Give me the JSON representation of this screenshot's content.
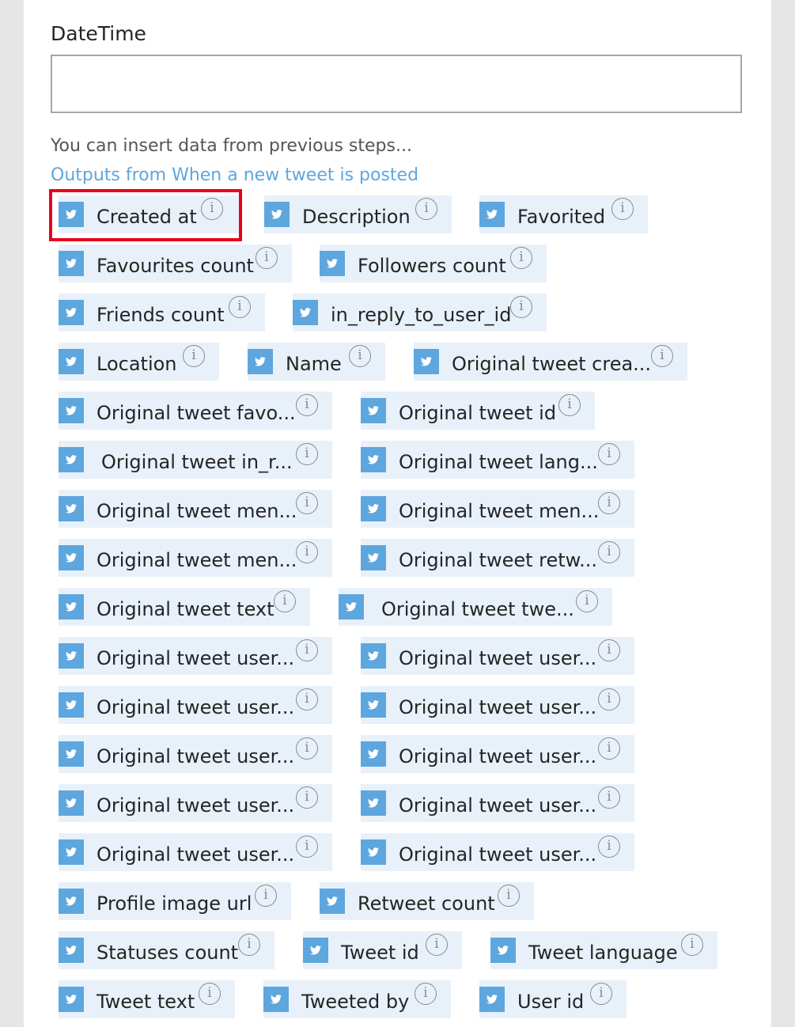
{
  "field": {
    "label": "DateTime",
    "value": ""
  },
  "hint": "You can insert data from previous steps...",
  "outputs_link": "Outputs from When a new tweet is posted",
  "tokens": [
    {
      "label": "Created at",
      "icon": "twitter-icon",
      "highlighted": true
    },
    {
      "label": "Description",
      "icon": "twitter-icon"
    },
    {
      "label": "Favorited",
      "icon": "twitter-icon"
    },
    {
      "label": "Favourites count",
      "icon": "twitter-icon"
    },
    {
      "label": "Followers count",
      "icon": "twitter-icon"
    },
    {
      "label": "Friends count",
      "icon": "twitter-icon"
    },
    {
      "label": "in_reply_to_user_id",
      "icon": "twitter-icon"
    },
    {
      "label": "Location",
      "icon": "twitter-icon"
    },
    {
      "label": "Name",
      "icon": "twitter-icon"
    },
    {
      "label": "Original tweet crea...",
      "icon": "twitter-icon"
    },
    {
      "label": "Original tweet favo...",
      "icon": "twitter-icon"
    },
    {
      "label": "Original tweet id",
      "icon": "twitter-icon"
    },
    {
      "label": "Original tweet in_r...",
      "icon": "twitter-icon"
    },
    {
      "label": "Original tweet lang...",
      "icon": "twitter-icon"
    },
    {
      "label": "Original tweet men...",
      "icon": "twitter-icon"
    },
    {
      "label": "Original tweet men...",
      "icon": "twitter-icon"
    },
    {
      "label": "Original tweet men...",
      "icon": "twitter-icon"
    },
    {
      "label": "Original tweet retw...",
      "icon": "twitter-icon"
    },
    {
      "label": "Original tweet text",
      "icon": "twitter-icon"
    },
    {
      "label": "Original tweet twe...",
      "icon": "twitter-icon"
    },
    {
      "label": "Original tweet user...",
      "icon": "twitter-icon"
    },
    {
      "label": "Original tweet user...",
      "icon": "twitter-icon"
    },
    {
      "label": "Original tweet user...",
      "icon": "twitter-icon"
    },
    {
      "label": "Original tweet user...",
      "icon": "twitter-icon"
    },
    {
      "label": "Original tweet user...",
      "icon": "twitter-icon"
    },
    {
      "label": "Original tweet user...",
      "icon": "twitter-icon"
    },
    {
      "label": "Original tweet user...",
      "icon": "twitter-icon"
    },
    {
      "label": "Original tweet user...",
      "icon": "twitter-icon"
    },
    {
      "label": "Original tweet user...",
      "icon": "twitter-icon"
    },
    {
      "label": "Original tweet user...",
      "icon": "twitter-icon"
    },
    {
      "label": "Profile image url",
      "icon": "twitter-icon"
    },
    {
      "label": "Retweet count",
      "icon": "twitter-icon"
    },
    {
      "label": "Statuses count",
      "icon": "twitter-icon"
    },
    {
      "label": "Tweet id",
      "icon": "twitter-icon"
    },
    {
      "label": "Tweet language",
      "icon": "twitter-icon"
    },
    {
      "label": "Tweet text",
      "icon": "twitter-icon"
    },
    {
      "label": "Tweeted by",
      "icon": "twitter-icon"
    },
    {
      "label": "User id",
      "icon": "twitter-icon"
    }
  ],
  "info_glyph": "i",
  "colors": {
    "accent": "#5ea6de",
    "token_bg": "#e8f1fa",
    "highlight": "#e8001c"
  }
}
